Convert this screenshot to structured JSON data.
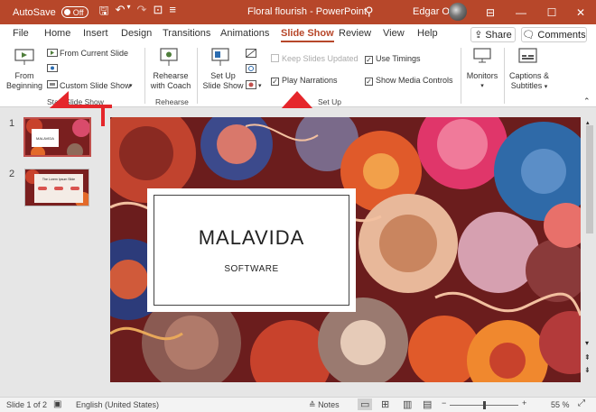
{
  "titlebar": {
    "autosave_label": "AutoSave",
    "autosave_state": "Off",
    "doc_title": "Floral flourish  -  PowerPoint",
    "user_name": "Edgar Otero",
    "accent": "#b7472a"
  },
  "tabs": [
    "File",
    "Home",
    "Insert",
    "Design",
    "Transitions",
    "Animations",
    "Slide Show",
    "Review",
    "View",
    "Help"
  ],
  "active_tab": "Slide Show",
  "share_label": "Share",
  "comments_label": "Comments",
  "ribbon": {
    "start": {
      "from_beginning_line1": "From",
      "from_beginning_line2": "Beginning",
      "from_current": "From Current Slide",
      "custom": "Custom Slide Show",
      "label": "Start Slide Show"
    },
    "rehearse": {
      "coach_line1": "Rehearse",
      "coach_line2": "with Coach",
      "label": "Rehearse"
    },
    "setup": {
      "setup_line1": "Set Up",
      "setup_line2": "Slide Show",
      "hide_slide": "Hide Slide",
      "record": "Record Slide Show",
      "rehearse_timings": "Rehearse Timings",
      "keep_updated": "Keep Slides Updated",
      "play_narrations": "Play Narrations",
      "use_timings": "Use Timings",
      "show_media_controls": "Show Media Controls",
      "label": "Set Up"
    },
    "monitors_label": "Monitors",
    "captions_line1": "Captions &",
    "captions_line2": "Subtitles"
  },
  "slides": [
    {
      "number": "1",
      "title": "MALAVIDA"
    },
    {
      "number": "2",
      "title": "The Lorem Ipsum Slide"
    }
  ],
  "slide": {
    "title": "MALAVIDA",
    "subtitle": "SOFTWARE"
  },
  "status": {
    "slide_info": "Slide 1 of 2",
    "language": "English (United States)",
    "notes_label": "Notes",
    "zoom": "55 %"
  }
}
